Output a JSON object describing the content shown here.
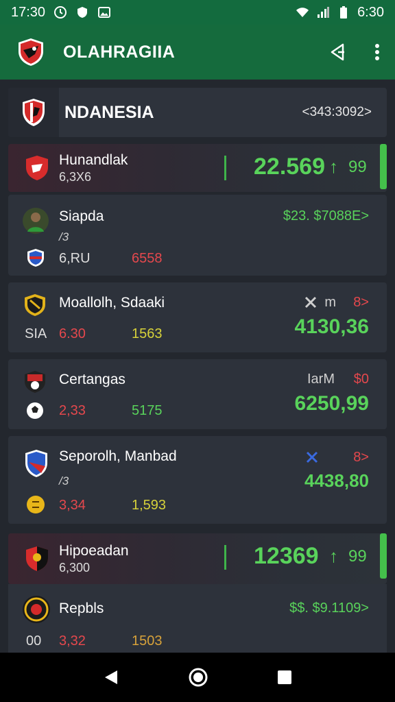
{
  "status": {
    "time": "17:30",
    "clock": "6:30"
  },
  "app": {
    "title": "OLAHRAGIIA"
  },
  "header": {
    "title": "NDANESIA",
    "code": "<343:3092>"
  },
  "highlight1": {
    "name": "Hunandlak",
    "sub": "6,3X6",
    "value": "22.569",
    "arrow": "↑",
    "change": "99"
  },
  "match1": {
    "name": "Siapda",
    "sub": "/3",
    "v1": "6,RU",
    "v2": "6558",
    "right": "$23. $7088E>"
  },
  "match2": {
    "name": "Moallolh, Sdaaki",
    "label": "SIA",
    "v1": "6.30",
    "v2": "1563",
    "right_a": "m",
    "right_b": "8>",
    "big": "4130,36"
  },
  "match3": {
    "name": "Certangas",
    "v1": "2,33",
    "v2": "5175",
    "right_a": "IarM",
    "right_b": "$0",
    "big": "6250,99"
  },
  "match4": {
    "name": "Seporolh, Manbad",
    "sub": "/3",
    "v1": "3,34",
    "v2": "1,593",
    "right_b": "8>",
    "big": "4438,80"
  },
  "highlight2": {
    "name": "Hipoeadan",
    "sub": "6,300",
    "value": "12369",
    "arrow": "↑",
    "change": "99"
  },
  "match5": {
    "name": "Repbls",
    "label": "00",
    "v1": "3,32",
    "v2": "1503",
    "right": "$$. $9.1109>"
  },
  "colors": {
    "green": "#59d35b",
    "red": "#e5484d",
    "yellow": "#d7d23a",
    "appbar": "#156b3d"
  }
}
